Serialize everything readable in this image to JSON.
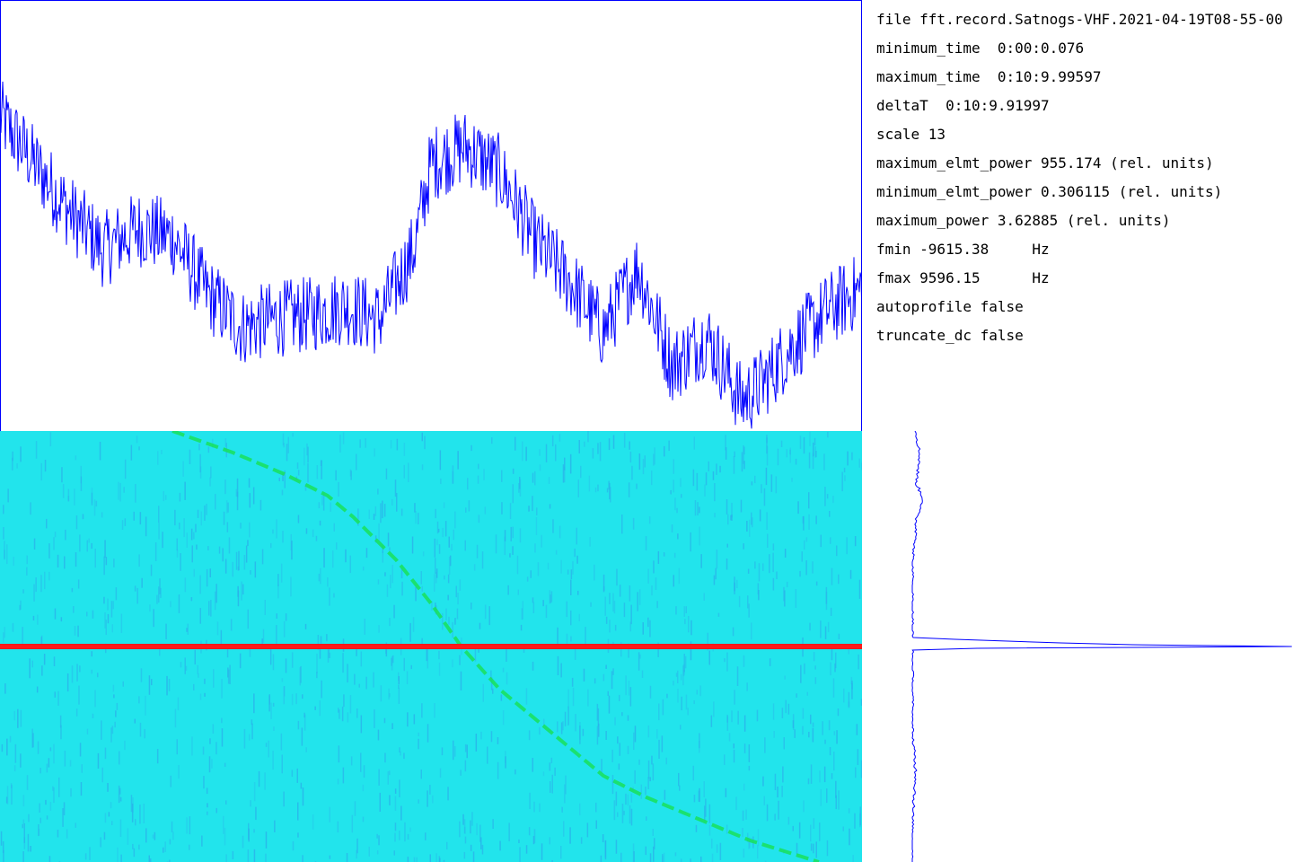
{
  "info": {
    "file": "file fft.record.Satnogs-VHF.2021-04-19T08-55-00",
    "minimum_time": "minimum_time  0:00:0.076",
    "maximum_time": "maximum_time  0:10:9.99597",
    "deltaT": "deltaT  0:10:9.91997",
    "scale": "scale 13",
    "maximum_elmt_power": "maximum_elmt_power 955.174 (rel. units)",
    "minimum_elmt_power": "minimum_elmt_power 0.306115 (rel. units)",
    "maximum_power": "maximum_power 3.62885 (rel. units)",
    "fmin": "fmin -9615.38     Hz",
    "fmax": "fmax 9596.15      Hz",
    "autoprofile": "autoprofile false",
    "truncate_dc": "truncate_dc false"
  },
  "colors": {
    "power_line": "#0000ff",
    "axis": "#0000ff",
    "waterfall_bg": "#22e4ec",
    "waterfall_noise": "#2bb0ea",
    "doppler_trace": "#19e05a",
    "dc_line": "#ff1a1a"
  },
  "chart_data": [
    {
      "type": "line",
      "series": [
        {
          "x": [
            0,
            0.04,
            0.08,
            0.12,
            0.16,
            0.2,
            0.24,
            0.28,
            0.32,
            0.36,
            0.4,
            0.44,
            0.48,
            0.5,
            0.54,
            0.58,
            0.62,
            0.66,
            0.7,
            0.74,
            0.78,
            0.82,
            0.86,
            0.88,
            0.92,
            0.96,
            1.0
          ],
          "values": [
            0.73,
            0.62,
            0.51,
            0.42,
            0.47,
            0.45,
            0.32,
            0.24,
            0.26,
            0.27,
            0.29,
            0.26,
            0.42,
            0.62,
            0.66,
            0.6,
            0.44,
            0.35,
            0.23,
            0.38,
            0.15,
            0.22,
            0.07,
            0.1,
            0.2,
            0.28,
            0.33
          ]
        }
      ],
      "xlim": [
        0,
        1
      ],
      "ylim": [
        0,
        1
      ]
    },
    {
      "type": "heatmap",
      "x_label_min": "fmin -9615.38 Hz",
      "x_label_max": "fmax 9596.15 Hz",
      "doppler_trace": {
        "time_fraction": [
          0.0,
          0.05,
          0.1,
          0.15,
          0.2,
          0.3,
          0.4,
          0.5,
          0.6,
          0.7,
          0.8,
          0.85,
          0.9,
          0.95,
          1.0
        ],
        "freq_fraction": [
          0.2,
          0.27,
          0.33,
          0.38,
          0.41,
          0.46,
          0.5,
          0.535,
          0.58,
          0.64,
          0.7,
          0.75,
          0.81,
          0.87,
          0.95
        ]
      },
      "dc_line_time_fraction": 0.5
    },
    {
      "type": "line",
      "orientation": "vertical",
      "series": [
        {
          "y": [
            0.0,
            0.06,
            0.12,
            0.16,
            0.2,
            0.25,
            0.3,
            0.4,
            0.48,
            0.495,
            0.5,
            0.505,
            0.52,
            0.6,
            0.7,
            0.8,
            0.9,
            1.0
          ],
          "values": [
            0.01,
            0.02,
            0.01,
            0.03,
            0.01,
            0.01,
            0.0,
            0.0,
            0.0,
            0.5,
            1.0,
            0.0,
            0.0,
            0.0,
            0.0,
            0.01,
            0.0,
            0.0
          ]
        }
      ],
      "xlim": [
        0,
        1
      ],
      "ylim": [
        0,
        1
      ]
    }
  ]
}
